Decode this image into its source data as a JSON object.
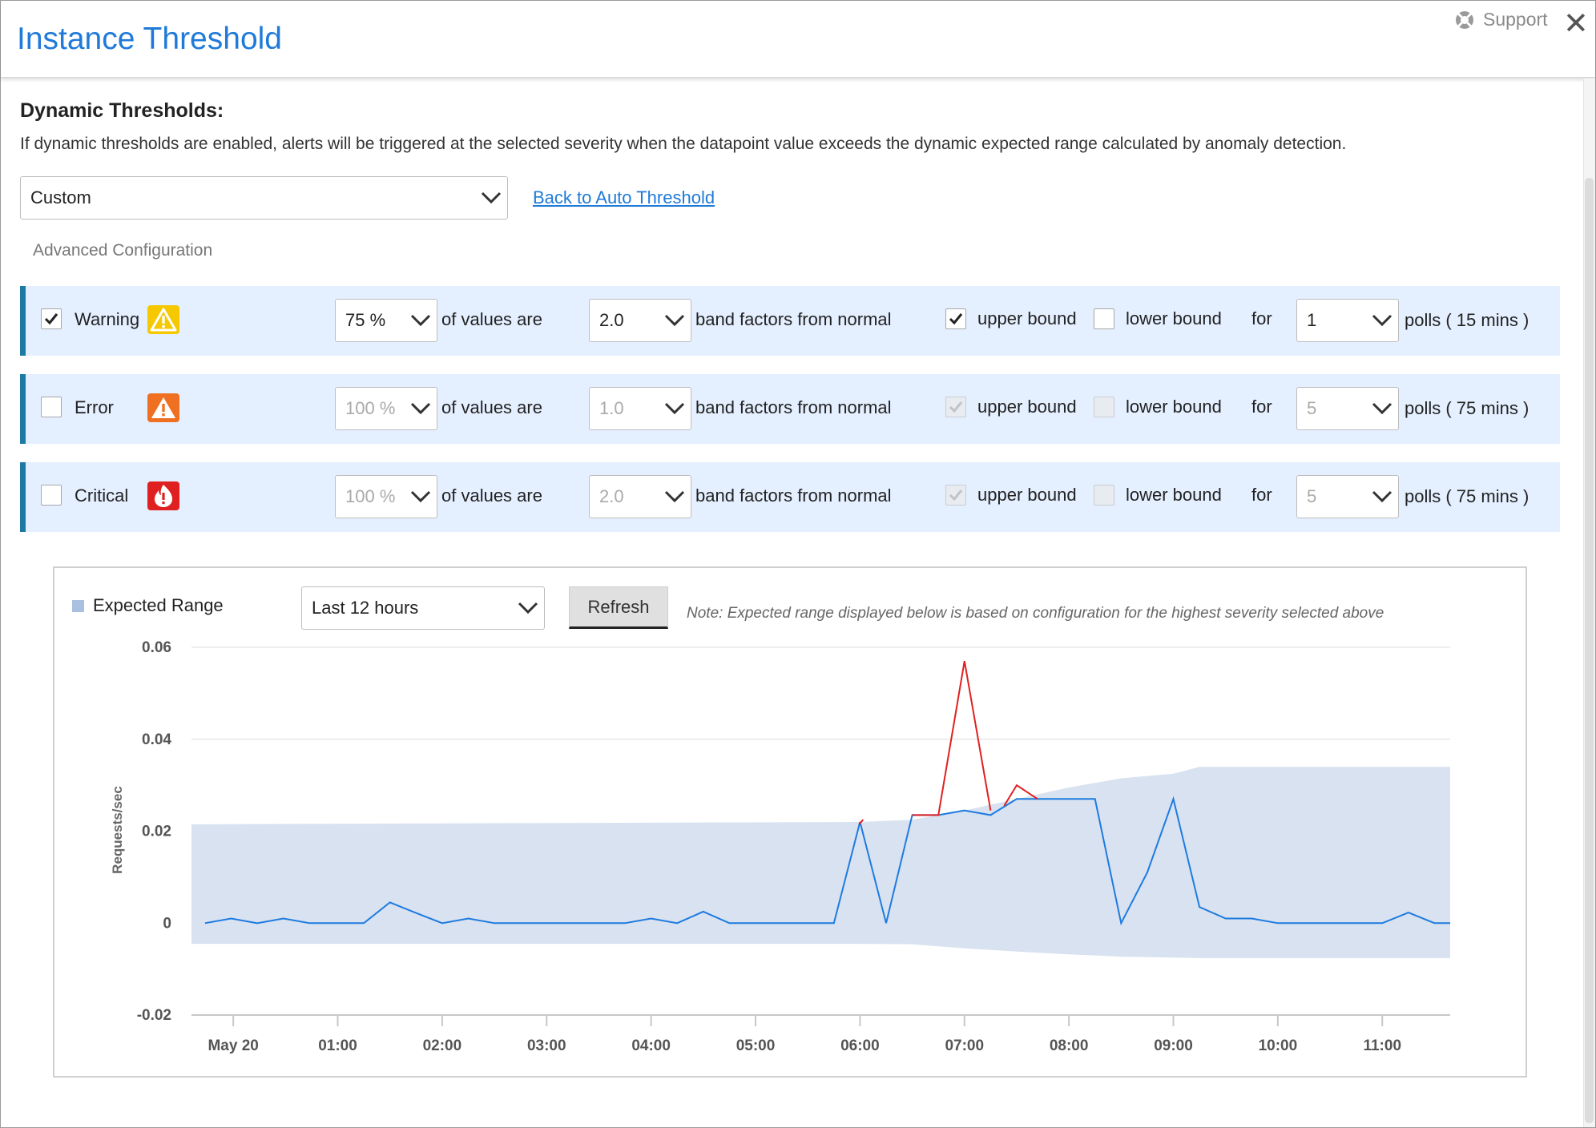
{
  "header": {
    "title": "Instance Threshold",
    "support_label": "Support"
  },
  "dynamic": {
    "heading": "Dynamic Thresholds:",
    "description": "If dynamic thresholds are enabled, alerts will be triggered at the selected severity when the datapoint value exceeds the dynamic expected range calculated by anomaly detection.",
    "mode_value": "Custom",
    "back_link": "Back to Auto Threshold",
    "advanced_label": "Advanced Configuration"
  },
  "rows": [
    {
      "severity": "Warning",
      "enabled": true,
      "percent": "75 %",
      "band": "2.0",
      "upper": true,
      "lower": false,
      "polls": "1",
      "polls_text": "polls ( 15 mins )",
      "disabled": false,
      "icon": "warning-icon",
      "color": "#f5c800"
    },
    {
      "severity": "Error",
      "enabled": false,
      "percent": "100 %",
      "band": "1.0",
      "upper": true,
      "lower": false,
      "polls": "5",
      "polls_text": "polls ( 75 mins )",
      "disabled": true,
      "icon": "error-icon",
      "color": "#f07022"
    },
    {
      "severity": "Critical",
      "enabled": false,
      "percent": "100 %",
      "band": "2.0",
      "upper": true,
      "lower": false,
      "polls": "5",
      "polls_text": "polls ( 75 mins )",
      "disabled": true,
      "icon": "critical-fire-icon",
      "color": "#e02020"
    }
  ],
  "labels": {
    "of_values_are": "of values are",
    "band_factors": "band factors from normal",
    "upper_bound": "upper bound",
    "lower_bound": "lower bound",
    "for": "for"
  },
  "chart_controls": {
    "legend": "Expected Range",
    "range_value": "Last 12 hours",
    "refresh_label": "Refresh",
    "note": "Note: Expected range displayed below is based on configuration for the highest severity selected above"
  },
  "chart_data": {
    "type": "line",
    "ylabel": "Requests/sec",
    "ylim": [
      -0.02,
      0.06
    ],
    "yticks": [
      {
        "v": 0.06,
        "label": "0.06"
      },
      {
        "v": 0.04,
        "label": "0.04"
      },
      {
        "v": 0.02,
        "label": "0.02"
      },
      {
        "v": 0,
        "label": "0"
      },
      {
        "v": -0.02,
        "label": "-0.02"
      }
    ],
    "xlim": [
      -0.4,
      11.65
    ],
    "xticks": [
      {
        "t": 0,
        "label": "May 20"
      },
      {
        "t": 1,
        "label": "01:00"
      },
      {
        "t": 2,
        "label": "02:00"
      },
      {
        "t": 3,
        "label": "03:00"
      },
      {
        "t": 4,
        "label": "04:00"
      },
      {
        "t": 5,
        "label": "05:00"
      },
      {
        "t": 6,
        "label": "06:00"
      },
      {
        "t": 7,
        "label": "07:00"
      },
      {
        "t": 8,
        "label": "08:00"
      },
      {
        "t": 9,
        "label": "09:00"
      },
      {
        "t": 10,
        "label": "10:00"
      },
      {
        "t": 11,
        "label": "11:00"
      }
    ],
    "expected_range": {
      "upper": [
        [
          -0.4,
          0.0215
        ],
        [
          6.0,
          0.022
        ],
        [
          6.5,
          0.0225
        ],
        [
          7.0,
          0.0245
        ],
        [
          7.5,
          0.027
        ],
        [
          8.0,
          0.0295
        ],
        [
          8.5,
          0.0315
        ],
        [
          9.0,
          0.0325
        ],
        [
          9.25,
          0.034
        ],
        [
          11.65,
          0.034
        ]
      ],
      "lower": [
        [
          -0.4,
          -0.0045
        ],
        [
          6.0,
          -0.0045
        ],
        [
          6.5,
          -0.0046
        ],
        [
          7.0,
          -0.0055
        ],
        [
          7.5,
          -0.0062
        ],
        [
          8.0,
          -0.0068
        ],
        [
          8.5,
          -0.0073
        ],
        [
          9.0,
          -0.0075
        ],
        [
          9.25,
          -0.0076
        ],
        [
          11.65,
          -0.0076
        ]
      ]
    },
    "series": [
      {
        "color": "#1e7be0",
        "points": [
          [
            -0.27,
            0
          ],
          [
            -0.02,
            0.001
          ],
          [
            0.23,
            0
          ],
          [
            0.48,
            0.001
          ],
          [
            0.73,
            0
          ],
          [
            1.25,
            0
          ],
          [
            1.5,
            0.0045
          ],
          [
            1.75,
            0.0022
          ],
          [
            2.0,
            0
          ],
          [
            2.25,
            0.001
          ],
          [
            2.5,
            0
          ],
          [
            3.0,
            0
          ],
          [
            3.75,
            0
          ],
          [
            4.0,
            0.001
          ],
          [
            4.25,
            0
          ],
          [
            4.5,
            0.0025
          ],
          [
            4.75,
            0
          ],
          [
            5.0,
            0
          ],
          [
            5.5,
            0
          ],
          [
            5.75,
            0
          ],
          [
            6.0,
            0.022
          ],
          [
            6.25,
            0
          ],
          [
            6.5,
            0.0235
          ],
          [
            6.75,
            0.0235
          ],
          [
            7.0,
            0.0245
          ],
          [
            7.25,
            0.0235
          ],
          [
            7.5,
            0.027
          ],
          [
            7.75,
            0.027
          ],
          [
            8.0,
            0.027
          ],
          [
            8.25,
            0.027
          ],
          [
            8.5,
            0
          ],
          [
            8.75,
            0.011
          ],
          [
            9.0,
            0.027
          ],
          [
            9.25,
            0.0035
          ],
          [
            9.5,
            0.001
          ],
          [
            9.75,
            0.001
          ],
          [
            10.0,
            0
          ],
          [
            10.25,
            0
          ],
          [
            10.5,
            0
          ],
          [
            10.75,
            0
          ],
          [
            11.0,
            0
          ],
          [
            11.25,
            0.0023
          ],
          [
            11.5,
            0
          ],
          [
            11.65,
            0
          ]
        ]
      },
      {
        "color": "#e02020",
        "segments": [
          [
            [
              5.99,
              0.0215
            ],
            [
              6.03,
              0.0225
            ]
          ],
          [
            [
              6.5,
              0.0235
            ],
            [
              6.75,
              0.0235
            ],
            [
              7.0,
              0.057
            ],
            [
              7.25,
              0.0245
            ]
          ],
          [
            [
              7.38,
              0.0255
            ],
            [
              7.5,
              0.03
            ],
            [
              7.7,
              0.027
            ]
          ]
        ]
      }
    ]
  }
}
